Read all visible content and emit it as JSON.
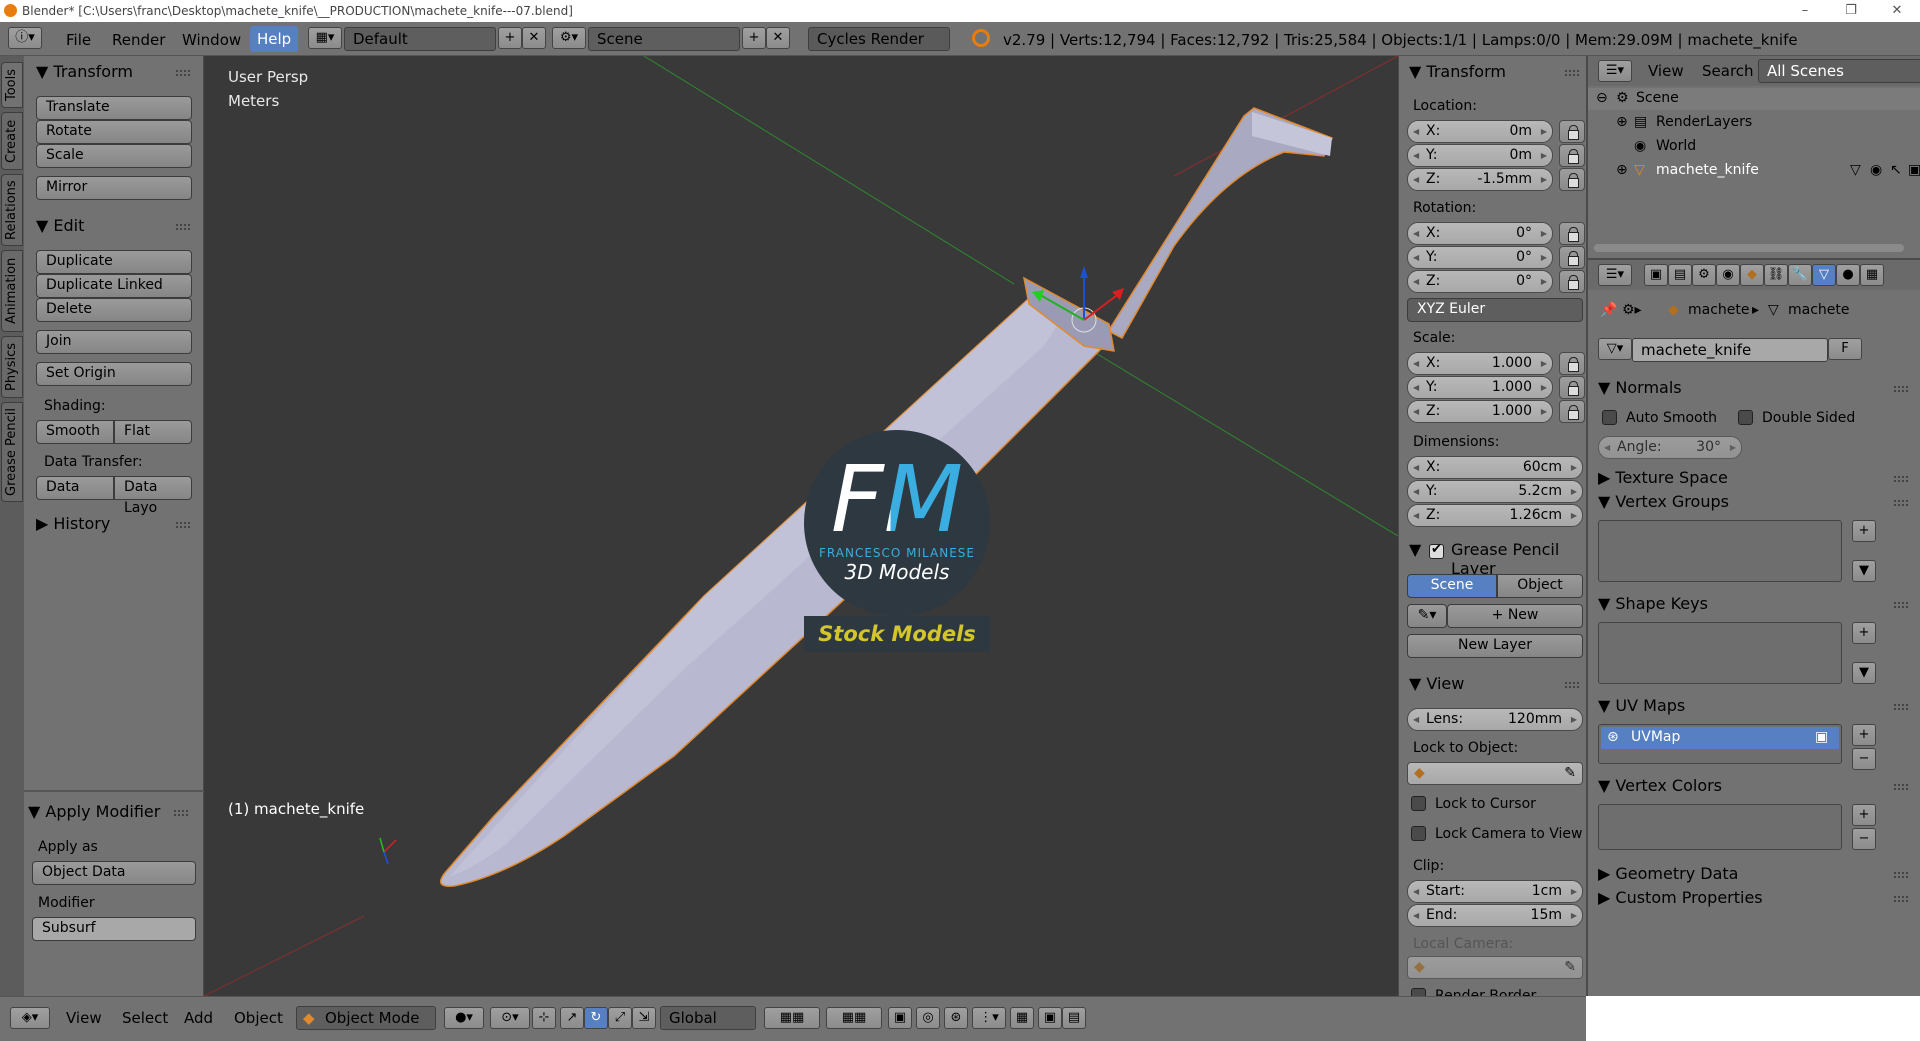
{
  "window": {
    "title": "Blender* [C:\\Users\\franc\\Desktop\\machete_knife\\__PRODUCTION\\machete_knife---07.blend]",
    "minimize": "–",
    "maximize": "❐",
    "close": "✕"
  },
  "menu": {
    "file": "File",
    "render": "Render",
    "window": "Window",
    "help": "Help"
  },
  "topbar": {
    "layout": "Default",
    "scene": "Scene",
    "engine": "Cycles Render",
    "stats": "v2.79 | Verts:12,794 | Faces:12,792 | Tris:25,584 | Objects:1/1 | Lamps:0/0 | Mem:29.09M | machete_knife"
  },
  "tool_tabs": [
    "Tools",
    "Create",
    "Relations",
    "Animation",
    "Physics",
    "Grease Pencil"
  ],
  "tools": {
    "transform_header": "Transform",
    "translate": "Translate",
    "rotate": "Rotate",
    "scale": "Scale",
    "mirror": "Mirror",
    "edit_header": "Edit",
    "duplicate": "Duplicate",
    "duplicate_linked": "Duplicate Linked",
    "delete": "Delete",
    "join": "Join",
    "set_origin": "Set Origin",
    "shading_label": "Shading:",
    "smooth": "Smooth",
    "flat": "Flat",
    "data_transfer_label": "Data Transfer:",
    "data": "Data",
    "data_layo": "Data Layo",
    "history_header": "History"
  },
  "operator": {
    "header": "Apply Modifier",
    "apply_as_label": "Apply as",
    "apply_as_value": "Object Data",
    "modifier_label": "Modifier",
    "modifier_value": "Subsurf"
  },
  "viewport": {
    "view_name": "User Persp",
    "units": "Meters",
    "object_label": "(1) machete_knife"
  },
  "watermark": {
    "logo": "FM",
    "name": "FRANCESCO MILANESE",
    "sub": "3D Models",
    "banner": "Stock Models"
  },
  "properties": {
    "transform_header": "Transform",
    "location_label": "Location:",
    "loc_x": "0m",
    "loc_y": "0m",
    "loc_z": "-1.5mm",
    "rotation_label": "Rotation:",
    "rot_x": "0°",
    "rot_y": "0°",
    "rot_z": "0°",
    "rot_mode": "XYZ Euler",
    "scale_label": "Scale:",
    "scale_x": "1.000",
    "scale_y": "1.000",
    "scale_z": "1.000",
    "dimensions_label": "Dimensions:",
    "dim_x": "60cm",
    "dim_y": "5.2cm",
    "dim_z": "1.26cm",
    "x": "X:",
    "y": "Y:",
    "z": "Z:",
    "gp_header": "Grease Pencil Layer",
    "gp_scene": "Scene",
    "gp_object": "Object",
    "gp_new": "New",
    "gp_new_layer": "New Layer",
    "view_header": "View",
    "lens_label": "Lens:",
    "lens_value": "120mm",
    "lock_object_label": "Lock to Object:",
    "lock_cursor": "Lock to Cursor",
    "lock_camera": "Lock Camera to View",
    "clip_label": "Clip:",
    "clip_start_label": "Start:",
    "clip_start": "1cm",
    "clip_end_label": "End:",
    "clip_end": "15m",
    "local_camera": "Local Camera:",
    "render_border": "Render Border"
  },
  "outliner": {
    "view": "View",
    "search": "Search",
    "all_scenes": "All Scenes",
    "scene": "Scene",
    "renderlayers": "RenderLayers",
    "world": "World",
    "object": "machete_knife"
  },
  "data_panel": {
    "crumb_obj": "machete",
    "crumb_mesh": "machete",
    "mesh_name": "machete_knife",
    "fake_user": "F",
    "normals": "Normals",
    "auto_smooth": "Auto Smooth",
    "double_sided": "Double Sided",
    "angle": "Angle:",
    "angle_value": "30°",
    "texture_space": "Texture Space",
    "vertex_groups": "Vertex Groups",
    "shape_keys": "Shape Keys",
    "uv_maps": "UV Maps",
    "uvmap": "UVMap",
    "vertex_colors": "Vertex Colors",
    "geometry_data": "Geometry Data",
    "custom_properties": "Custom Properties"
  },
  "bottombar": {
    "view": "View",
    "select": "Select",
    "add": "Add",
    "object": "Object",
    "mode": "Object Mode",
    "orientation": "Global"
  },
  "colors": {
    "viewport_bg": "#393939",
    "panel": "#727272",
    "highlight": "#5680c2",
    "knife": "#b8b8d0",
    "logo_text": "#3aaee0",
    "banner_text": "#d4c52a"
  }
}
